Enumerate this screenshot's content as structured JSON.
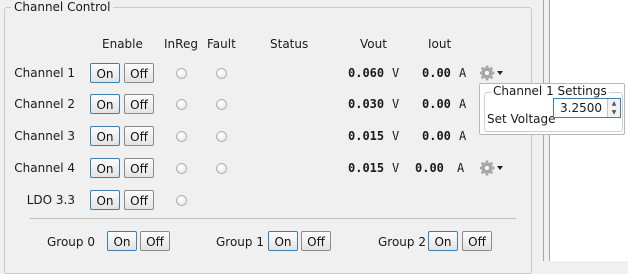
{
  "panel": {
    "title": "Channel Control"
  },
  "headers": {
    "enable": "Enable",
    "inreg": "InReg",
    "fault": "Fault",
    "status": "Status",
    "vout": "Vout",
    "iout": "Iout"
  },
  "channels": [
    {
      "label": "Channel 1",
      "vout": "0.060",
      "iout": "0.00"
    },
    {
      "label": "Channel 2",
      "vout": "0.030",
      "iout": "0.00"
    },
    {
      "label": "Channel 3",
      "vout": "0.015",
      "iout": "0.00"
    },
    {
      "label": "Channel 4",
      "vout": "0.015",
      "iout": "0.00"
    },
    {
      "label": "LDO 3.3"
    }
  ],
  "buttons": {
    "on": "On",
    "off": "Off"
  },
  "units": {
    "volt": "V",
    "amp": "A"
  },
  "groups": [
    {
      "label": "Group 0"
    },
    {
      "label": "Group 1"
    },
    {
      "label": "Group 2"
    }
  ],
  "settings_popup": {
    "title": "Channel 1 Settings",
    "field_label": "Set Voltage",
    "field_value": "3.2500"
  },
  "icons": {
    "gear": "gear-icon",
    "dropdown": "chevron-down-icon",
    "spin_up": "spin-up-arrow-icon",
    "spin_down": "spin-down-arrow-icon"
  }
}
